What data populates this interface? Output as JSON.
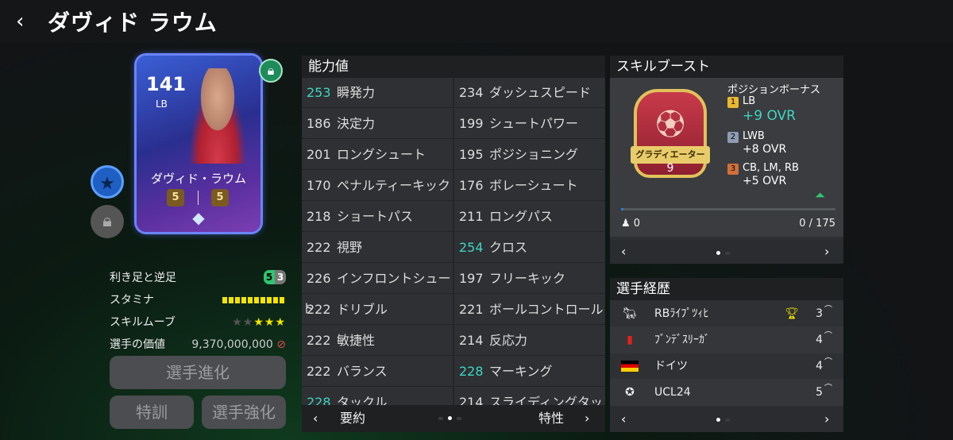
{
  "header": {
    "back_icon": "chevron-left-icon",
    "title": "ダヴィド ラウム"
  },
  "card": {
    "ovr": "141",
    "position": "LB",
    "name": "ダヴィド・ラウム",
    "level_left": "5",
    "level_right": "5",
    "lock_icon": "lock-icon"
  },
  "info": {
    "foot_label": "利き足と逆足",
    "foot_strong": "5",
    "foot_weak": "3",
    "stamina_label": "スタミナ",
    "skill_label": "スキルムーブ",
    "skill_stars": 3,
    "skill_stars_max": 5,
    "value_label": "選手の価値",
    "value": "9,370,000,000"
  },
  "buttons": {
    "advance": "選手進化",
    "training": "特訓",
    "enhance": "選手強化"
  },
  "attributes": {
    "title": "能力値",
    "left": [
      {
        "v": "253",
        "n": "瞬発力",
        "hi": true
      },
      {
        "v": "186",
        "n": "決定力",
        "hi": false
      },
      {
        "v": "201",
        "n": "ロングシュート",
        "hi": false
      },
      {
        "v": "170",
        "n": "ペナルティーキック",
        "hi": false
      },
      {
        "v": "218",
        "n": "ショートパス",
        "hi": false
      },
      {
        "v": "222",
        "n": "視野",
        "hi": false
      },
      {
        "v": "226",
        "n": "インフロントシュート",
        "hi": false
      },
      {
        "v": "222",
        "n": "ドリブル",
        "hi": false
      },
      {
        "v": "222",
        "n": "敏捷性",
        "hi": false
      },
      {
        "v": "222",
        "n": "バランス",
        "hi": false
      },
      {
        "v": "228",
        "n": "タックル",
        "hi": true
      }
    ],
    "right": [
      {
        "v": "234",
        "n": "ダッシュスピード",
        "hi": false
      },
      {
        "v": "199",
        "n": "シュートパワー",
        "hi": false
      },
      {
        "v": "195",
        "n": "ポジショニング",
        "hi": false
      },
      {
        "v": "176",
        "n": "ボレーシュート",
        "hi": false
      },
      {
        "v": "211",
        "n": "ロングパス",
        "hi": false
      },
      {
        "v": "254",
        "n": "クロス",
        "hi": true
      },
      {
        "v": "197",
        "n": "フリーキック",
        "hi": false
      },
      {
        "v": "221",
        "n": "ボールコントロール",
        "hi": false
      },
      {
        "v": "214",
        "n": "反応力",
        "hi": false
      },
      {
        "v": "228",
        "n": "マーキング",
        "hi": true
      },
      {
        "v": "214",
        "n": "スライディングタックル",
        "hi": false
      }
    ],
    "footer_left": "要約",
    "footer_right": "特性"
  },
  "boost": {
    "title": "スキルブースト",
    "emblem_label": "グラディエーター",
    "emblem_level": "9",
    "bonus_title": "ポジションボーナス",
    "bonuses": [
      {
        "rank": "1",
        "pos": "LB",
        "ovr": "+9 OVR",
        "color": "#e9b830"
      },
      {
        "rank": "2",
        "pos": "LWB",
        "ovr": "+8 OVR",
        "color": "#8e9bb2"
      },
      {
        "rank": "3",
        "pos": "CB, LM, RB",
        "ovr": "+5 OVR",
        "color": "#d0703a"
      }
    ],
    "progress_left": "0",
    "progress_right": "0 / 175",
    "progress_value": 0
  },
  "career": {
    "title": "選手経歴",
    "rows": [
      {
        "icon": "rb-leipzig-icon",
        "name": "RBﾗｲﾌﾟﾂｨﾋ",
        "count": "3",
        "trophy": true
      },
      {
        "icon": "bundesliga-icon",
        "name": "ﾌﾞﾝﾃﾞｽﾘｰｶﾞ",
        "count": "4",
        "trophy": false
      },
      {
        "icon": "germany-flag-icon",
        "name": "ドイツ",
        "count": "4",
        "trophy": false
      },
      {
        "icon": "ucl-ball-icon",
        "name": "UCL24",
        "count": "5",
        "trophy": false
      }
    ]
  },
  "colors": {
    "accent": "#3dd6c2",
    "gold": "#f3e500",
    "panel": "#2e3033"
  }
}
